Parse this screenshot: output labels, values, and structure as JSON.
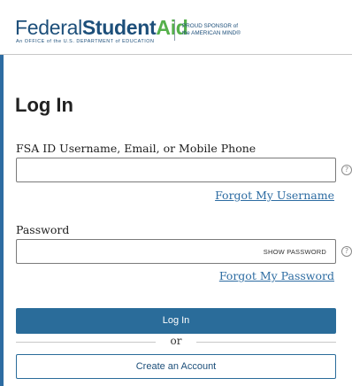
{
  "header": {
    "logo": {
      "federal": "Federal",
      "student": "Student",
      "aid": "Aid",
      "subtitle": "An OFFICE of the U.S. DEPARTMENT of EDUCATION"
    },
    "sponsor": {
      "line1": "PROUD SPONSOR of",
      "line2": "the AMERICAN MIND®"
    }
  },
  "login": {
    "title": "Log In",
    "username_label": "FSA ID Username, Email, or Mobile Phone",
    "username_value": "",
    "forgot_username": "Forgot My Username",
    "password_label": "Password",
    "password_value": "",
    "show_password": "SHOW PASSWORD",
    "forgot_password": "Forgot My Password",
    "login_button": "Log In",
    "or_text": "or",
    "create_account_button": "Create an Account",
    "help_glyph": "?"
  },
  "colors": {
    "brand_blue": "#1d4f7a",
    "brand_green": "#55b04b",
    "button_blue": "#2a6c9a",
    "link_blue": "#2d6ca2"
  }
}
